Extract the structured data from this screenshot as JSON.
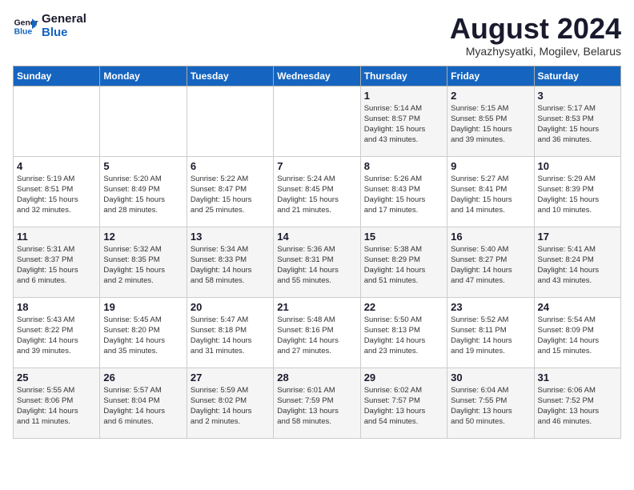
{
  "logo": {
    "line1": "General",
    "line2": "Blue"
  },
  "title": "August 2024",
  "subtitle": "Myazhysyatki, Mogilev, Belarus",
  "weekdays": [
    "Sunday",
    "Monday",
    "Tuesday",
    "Wednesday",
    "Thursday",
    "Friday",
    "Saturday"
  ],
  "weeks": [
    [
      {
        "day": "",
        "info": ""
      },
      {
        "day": "",
        "info": ""
      },
      {
        "day": "",
        "info": ""
      },
      {
        "day": "",
        "info": ""
      },
      {
        "day": "1",
        "info": "Sunrise: 5:14 AM\nSunset: 8:57 PM\nDaylight: 15 hours\nand 43 minutes."
      },
      {
        "day": "2",
        "info": "Sunrise: 5:15 AM\nSunset: 8:55 PM\nDaylight: 15 hours\nand 39 minutes."
      },
      {
        "day": "3",
        "info": "Sunrise: 5:17 AM\nSunset: 8:53 PM\nDaylight: 15 hours\nand 36 minutes."
      }
    ],
    [
      {
        "day": "4",
        "info": "Sunrise: 5:19 AM\nSunset: 8:51 PM\nDaylight: 15 hours\nand 32 minutes."
      },
      {
        "day": "5",
        "info": "Sunrise: 5:20 AM\nSunset: 8:49 PM\nDaylight: 15 hours\nand 28 minutes."
      },
      {
        "day": "6",
        "info": "Sunrise: 5:22 AM\nSunset: 8:47 PM\nDaylight: 15 hours\nand 25 minutes."
      },
      {
        "day": "7",
        "info": "Sunrise: 5:24 AM\nSunset: 8:45 PM\nDaylight: 15 hours\nand 21 minutes."
      },
      {
        "day": "8",
        "info": "Sunrise: 5:26 AM\nSunset: 8:43 PM\nDaylight: 15 hours\nand 17 minutes."
      },
      {
        "day": "9",
        "info": "Sunrise: 5:27 AM\nSunset: 8:41 PM\nDaylight: 15 hours\nand 14 minutes."
      },
      {
        "day": "10",
        "info": "Sunrise: 5:29 AM\nSunset: 8:39 PM\nDaylight: 15 hours\nand 10 minutes."
      }
    ],
    [
      {
        "day": "11",
        "info": "Sunrise: 5:31 AM\nSunset: 8:37 PM\nDaylight: 15 hours\nand 6 minutes."
      },
      {
        "day": "12",
        "info": "Sunrise: 5:32 AM\nSunset: 8:35 PM\nDaylight: 15 hours\nand 2 minutes."
      },
      {
        "day": "13",
        "info": "Sunrise: 5:34 AM\nSunset: 8:33 PM\nDaylight: 14 hours\nand 58 minutes."
      },
      {
        "day": "14",
        "info": "Sunrise: 5:36 AM\nSunset: 8:31 PM\nDaylight: 14 hours\nand 55 minutes."
      },
      {
        "day": "15",
        "info": "Sunrise: 5:38 AM\nSunset: 8:29 PM\nDaylight: 14 hours\nand 51 minutes."
      },
      {
        "day": "16",
        "info": "Sunrise: 5:40 AM\nSunset: 8:27 PM\nDaylight: 14 hours\nand 47 minutes."
      },
      {
        "day": "17",
        "info": "Sunrise: 5:41 AM\nSunset: 8:24 PM\nDaylight: 14 hours\nand 43 minutes."
      }
    ],
    [
      {
        "day": "18",
        "info": "Sunrise: 5:43 AM\nSunset: 8:22 PM\nDaylight: 14 hours\nand 39 minutes."
      },
      {
        "day": "19",
        "info": "Sunrise: 5:45 AM\nSunset: 8:20 PM\nDaylight: 14 hours\nand 35 minutes."
      },
      {
        "day": "20",
        "info": "Sunrise: 5:47 AM\nSunset: 8:18 PM\nDaylight: 14 hours\nand 31 minutes."
      },
      {
        "day": "21",
        "info": "Sunrise: 5:48 AM\nSunset: 8:16 PM\nDaylight: 14 hours\nand 27 minutes."
      },
      {
        "day": "22",
        "info": "Sunrise: 5:50 AM\nSunset: 8:13 PM\nDaylight: 14 hours\nand 23 minutes."
      },
      {
        "day": "23",
        "info": "Sunrise: 5:52 AM\nSunset: 8:11 PM\nDaylight: 14 hours\nand 19 minutes."
      },
      {
        "day": "24",
        "info": "Sunrise: 5:54 AM\nSunset: 8:09 PM\nDaylight: 14 hours\nand 15 minutes."
      }
    ],
    [
      {
        "day": "25",
        "info": "Sunrise: 5:55 AM\nSunset: 8:06 PM\nDaylight: 14 hours\nand 11 minutes."
      },
      {
        "day": "26",
        "info": "Sunrise: 5:57 AM\nSunset: 8:04 PM\nDaylight: 14 hours\nand 6 minutes."
      },
      {
        "day": "27",
        "info": "Sunrise: 5:59 AM\nSunset: 8:02 PM\nDaylight: 14 hours\nand 2 minutes."
      },
      {
        "day": "28",
        "info": "Sunrise: 6:01 AM\nSunset: 7:59 PM\nDaylight: 13 hours\nand 58 minutes."
      },
      {
        "day": "29",
        "info": "Sunrise: 6:02 AM\nSunset: 7:57 PM\nDaylight: 13 hours\nand 54 minutes."
      },
      {
        "day": "30",
        "info": "Sunrise: 6:04 AM\nSunset: 7:55 PM\nDaylight: 13 hours\nand 50 minutes."
      },
      {
        "day": "31",
        "info": "Sunrise: 6:06 AM\nSunset: 7:52 PM\nDaylight: 13 hours\nand 46 minutes."
      }
    ]
  ]
}
